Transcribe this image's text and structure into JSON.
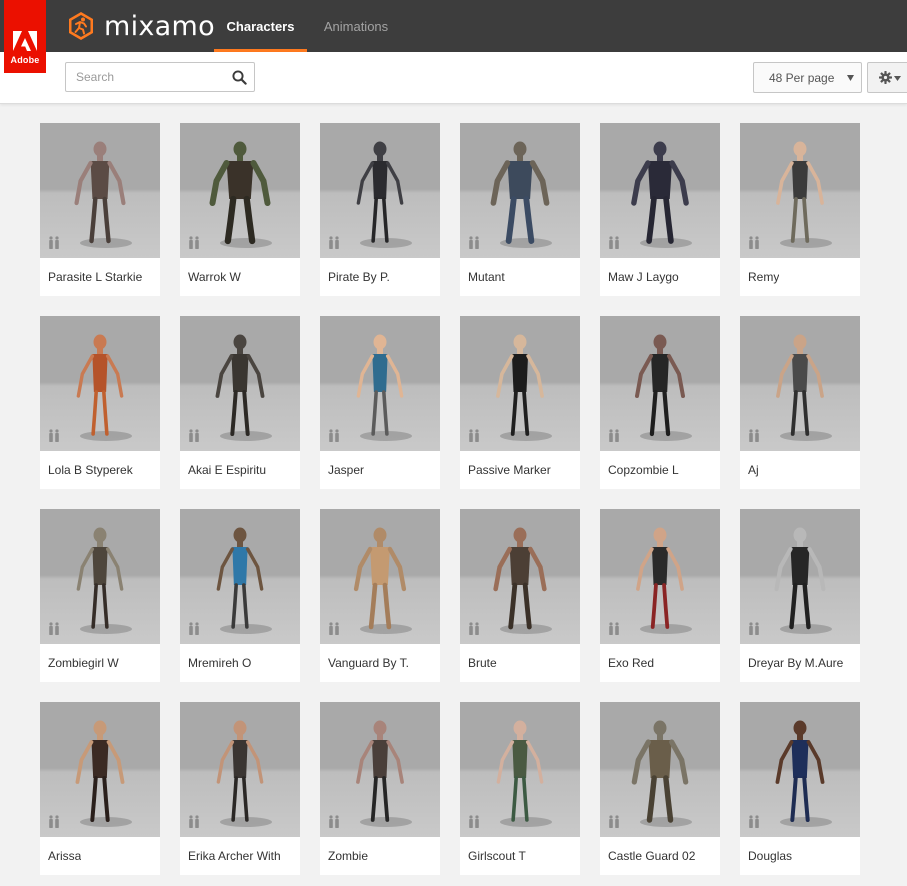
{
  "brand": {
    "adobe_label": "Adobe",
    "app_name": "mixamo",
    "accent_color": "#ff7a1f",
    "adobe_red": "#eb1000"
  },
  "nav": {
    "tabs": [
      {
        "label": "Characters",
        "active": true
      },
      {
        "label": "Animations",
        "active": false
      }
    ]
  },
  "toolbar": {
    "search_placeholder": "Search",
    "per_page_selected": "48 Per page"
  },
  "characters": [
    {
      "name": "Parasite L Starkie",
      "skin": "#9a7f7a",
      "cloth": "#5b4b45",
      "legs": "#4a3f3a",
      "bulk": 1.05
    },
    {
      "name": "Warrok W",
      "skin": "#4f5a3c",
      "cloth": "#3a3229",
      "legs": "#2d2a22",
      "bulk": 1.5
    },
    {
      "name": "Pirate By P.",
      "skin": "#3f3f44",
      "cloth": "#2b2b2f",
      "legs": "#262628",
      "bulk": 0.85
    },
    {
      "name": "Mutant",
      "skin": "#6c6458",
      "cloth": "#3d4a5c",
      "legs": "#3b4b63",
      "bulk": 1.4
    },
    {
      "name": "Maw J Laygo",
      "skin": "#3c3c4c",
      "cloth": "#2a2a38",
      "legs": "#262633",
      "bulk": 1.35
    },
    {
      "name": "Remy",
      "skin": "#d8b49a",
      "cloth": "#3b3b3b",
      "legs": "#6e6a5c",
      "bulk": 0.9
    },
    {
      "name": "Lola B Styperek",
      "skin": "#c97a52",
      "cloth": "#b5532a",
      "legs": "#c0602f",
      "bulk": 0.85
    },
    {
      "name": "Akai E Espiritu",
      "skin": "#4a4540",
      "cloth": "#3a3631",
      "legs": "#2c2925",
      "bulk": 0.95
    },
    {
      "name": "Jasper",
      "skin": "#e0b594",
      "cloth": "#2f6c8f",
      "legs": "#5b5b5b",
      "bulk": 0.85
    },
    {
      "name": "Passive Marker",
      "skin": "#d6b79b",
      "cloth": "#1c1c1c",
      "legs": "#1f1f1f",
      "bulk": 0.9
    },
    {
      "name": "Copzombie L",
      "skin": "#7a5a52",
      "cloth": "#262626",
      "legs": "#1e1e1e",
      "bulk": 1.0
    },
    {
      "name": "Aj",
      "skin": "#caa488",
      "cloth": "#4a4a4a",
      "legs": "#2f2f2f",
      "bulk": 0.9
    },
    {
      "name": "Zombiegirl W",
      "skin": "#8a8272",
      "cloth": "#4e463c",
      "legs": "#352d28",
      "bulk": 0.85
    },
    {
      "name": "Mremireh O",
      "skin": "#6d5540",
      "cloth": "#2f78a8",
      "legs": "#3a3a3a",
      "bulk": 0.85
    },
    {
      "name": "Vanguard By T.",
      "skin": "#b08b68",
      "cloth": "#c49a71",
      "legs": "#a47d5a",
      "bulk": 1.1
    },
    {
      "name": "Brute",
      "skin": "#9a6e58",
      "cloth": "#4c3f35",
      "legs": "#3b3128",
      "bulk": 1.15
    },
    {
      "name": "Exo Red",
      "skin": "#d0a488",
      "cloth": "#2a2a2a",
      "legs": "#8a2424",
      "bulk": 0.9
    },
    {
      "name": "Dreyar By M.Aure",
      "skin": "#b8b8b8",
      "cloth": "#262626",
      "legs": "#202020",
      "bulk": 1.05
    },
    {
      "name": "Arissa",
      "skin": "#c79a78",
      "cloth": "#3b2a23",
      "legs": "#2a1f1b",
      "bulk": 0.95
    },
    {
      "name": "Erika Archer With",
      "skin": "#c29478",
      "cloth": "#3a3532",
      "legs": "#2a2725",
      "bulk": 0.85
    },
    {
      "name": "Zombie",
      "skin": "#a8847a",
      "cloth": "#4a3f3a",
      "legs": "#262626",
      "bulk": 0.9
    },
    {
      "name": "Girlscout T",
      "skin": "#d3b09e",
      "cloth": "#4a5a42",
      "legs": "#3c5a42",
      "bulk": 0.85
    },
    {
      "name": "Castle Guard 02",
      "skin": "#7a7466",
      "cloth": "#6a5e4a",
      "legs": "#4a4234",
      "bulk": 1.3
    },
    {
      "name": "Douglas",
      "skin": "#5a3a2a",
      "cloth": "#1e2f5a",
      "legs": "#1e2c52",
      "bulk": 0.95
    }
  ]
}
